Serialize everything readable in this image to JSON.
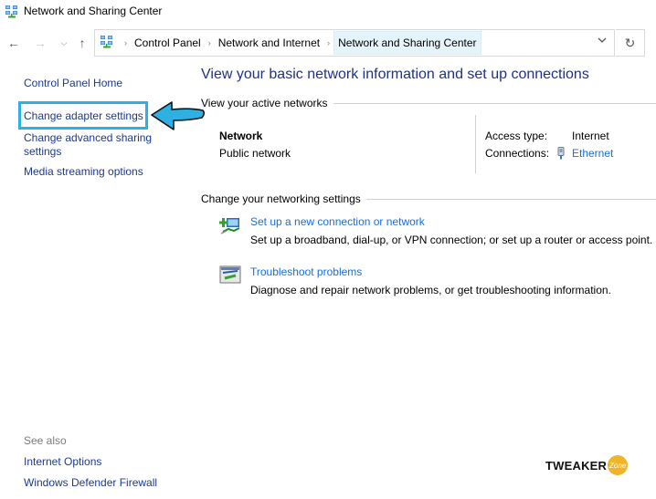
{
  "window": {
    "title": "Network and Sharing Center",
    "icon": "network-center-icon"
  },
  "navigation": {
    "back_icon": "arrow-left-icon",
    "forward_icon": "arrow-right-icon",
    "recent_icon": "chevron-down-icon",
    "up_icon": "arrow-up-icon",
    "back_glyph": "←",
    "forward_glyph": "→",
    "recent_glyph": "⌄",
    "up_glyph": "↑",
    "breadcrumb": [
      "Control Panel",
      "Network and Internet",
      "Network and Sharing Center"
    ],
    "separator_glyph": "›",
    "dropdown_glyph": "⌄",
    "refresh_glyph": "↻"
  },
  "sidebar": {
    "home": "Control Panel Home",
    "links": [
      "Change adapter settings",
      "Change advanced sharing settings",
      "Media streaming options"
    ],
    "see_also_label": "See also",
    "see_also": [
      "Internet Options",
      "Windows Defender Firewall"
    ]
  },
  "annotation": {
    "highlighted_item": "Change adapter settings",
    "color": "#2fb0e3"
  },
  "main": {
    "heading": "View your basic network information and set up connections",
    "active_networks_title": "View your active networks",
    "network": {
      "name": "Network",
      "type": "Public network",
      "access_type_label": "Access type:",
      "access_type_value": "Internet",
      "connections_label": "Connections:",
      "connections_value": "Ethernet",
      "connections_icon": "ethernet-icon"
    },
    "change_settings_title": "Change your networking settings",
    "tasks": [
      {
        "icon": "new-connection-icon",
        "link": "Set up a new connection or network",
        "description": "Set up a broadband, dial-up, or VPN connection; or set up a router or access point."
      },
      {
        "icon": "troubleshoot-icon",
        "link": "Troubleshoot problems",
        "description": "Diagnose and repair network problems, or get troubleshooting information."
      }
    ]
  },
  "watermark": {
    "text": "TWEAKER",
    "badge": "Zone"
  },
  "colors": {
    "link_dark": "#1c3a8c",
    "link_blue": "#1a6ed8",
    "heading": "#1e3287",
    "accent_callout": "#2fb0e3",
    "breadcrumb_highlight": "#e5f3fb"
  }
}
